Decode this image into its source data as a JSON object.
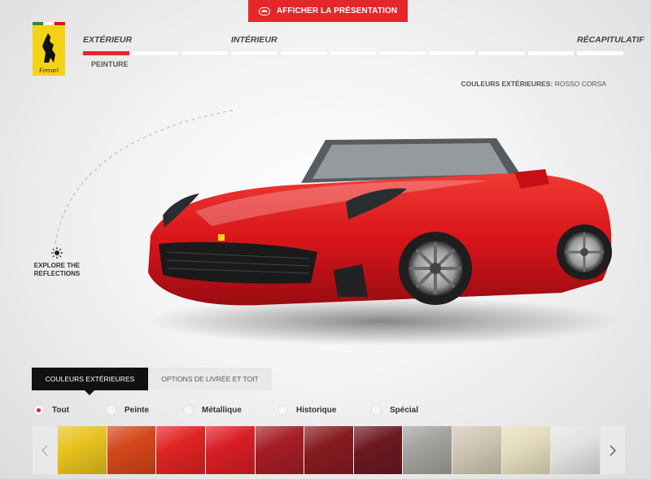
{
  "header": {
    "present_label": "AFFICHER LA PRÉSENTATION",
    "logo_text": "Ferrari"
  },
  "steps": [
    {
      "label": "EXTÉRIEUR"
    },
    {
      "label": "INTÉRIEUR"
    },
    {
      "label": "RÉCAPITULATIF"
    }
  ],
  "progress": {
    "total_segments": 11,
    "active_segment": 1
  },
  "sub_step": "PEINTURE",
  "summary": {
    "label": "COULEURS EXTÉRIEURES:",
    "value": "ROSSO CORSA"
  },
  "explore": {
    "line1": "EXPLORE THE",
    "line2": "REFLECTIONS"
  },
  "tabs": [
    {
      "label": "COULEURS EXTÉRIEURES",
      "active": true
    },
    {
      "label": "OPTIONS DE LIVRÉE ET TOIT",
      "active": false
    }
  ],
  "filters": [
    {
      "label": "Tout",
      "checked": true
    },
    {
      "label": "Peinte",
      "checked": false
    },
    {
      "label": "Métallique",
      "checked": false
    },
    {
      "label": "Historique",
      "checked": false
    },
    {
      "label": "Spécial",
      "checked": false
    }
  ],
  "swatches": [
    {
      "color": "#e7c21d"
    },
    {
      "color": "#d4461a"
    },
    {
      "color": "#df2323"
    },
    {
      "color": "#d81e24"
    },
    {
      "color": "#a51d25"
    },
    {
      "color": "#861b21"
    },
    {
      "color": "#6b1820"
    },
    {
      "color": "#a3a19c"
    },
    {
      "color": "#cfc6b2"
    },
    {
      "color": "#e4dcbc"
    },
    {
      "color": "#e3e3e1"
    }
  ],
  "colors": {
    "accent": "#e5262b",
    "car_body": "#d8141b"
  }
}
